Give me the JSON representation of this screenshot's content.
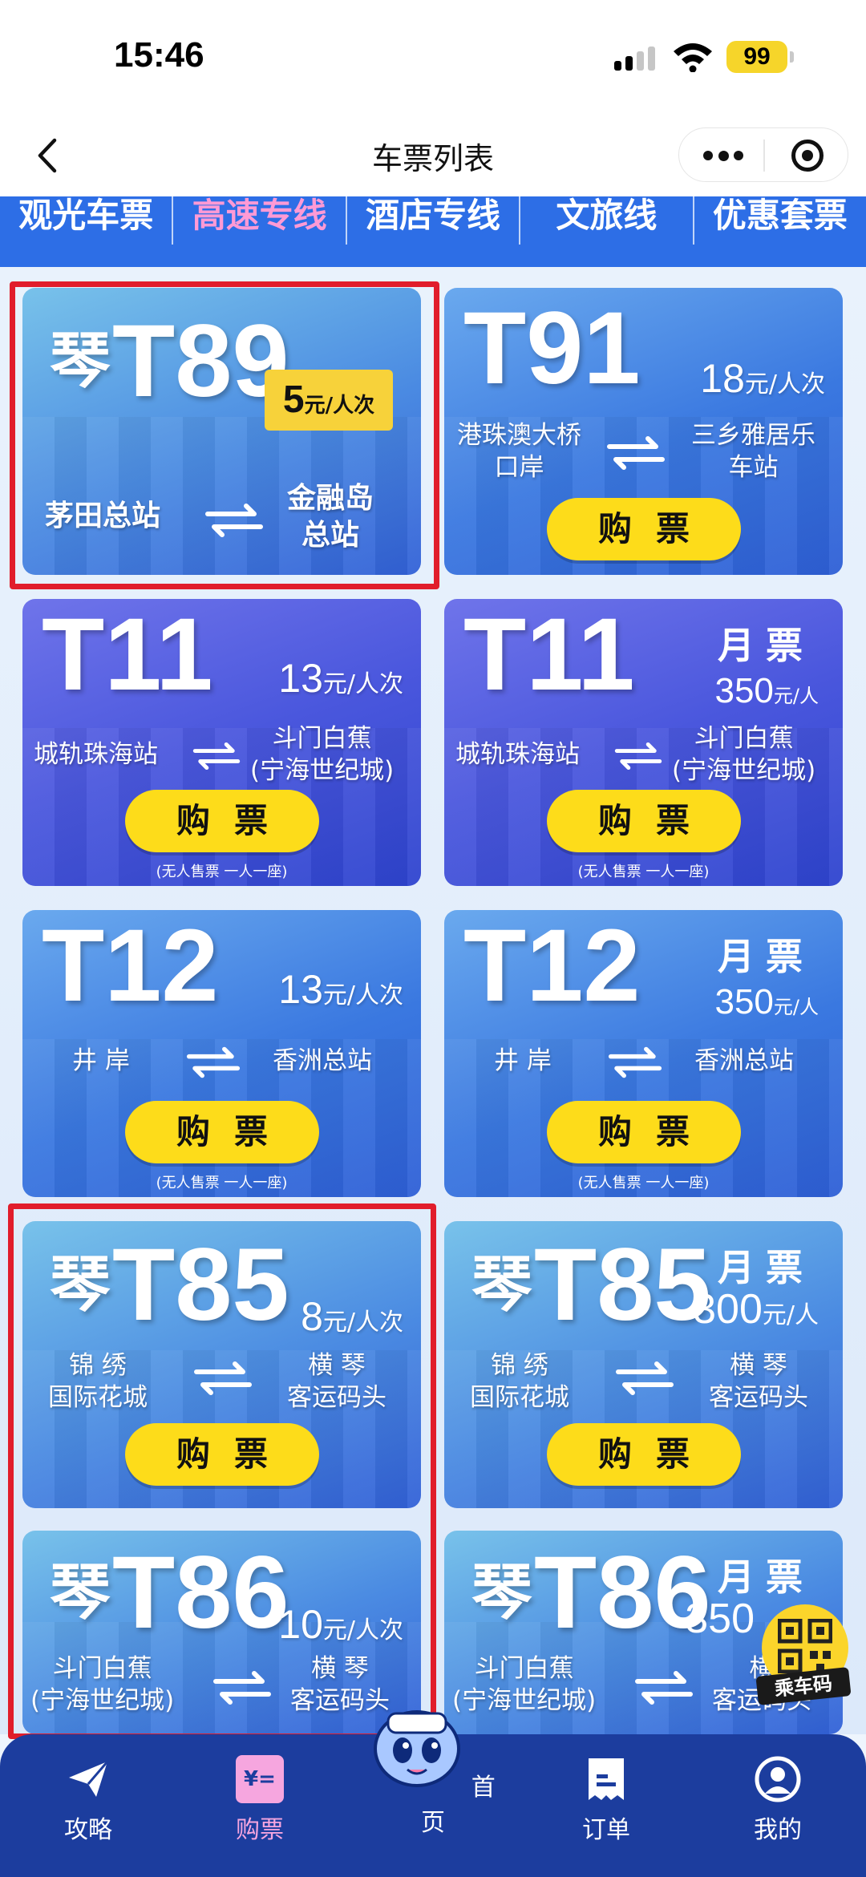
{
  "status": {
    "time": "15:46",
    "battery": "99"
  },
  "nav": {
    "title": "车票列表"
  },
  "tabs": [
    "观光车票",
    "高速专线",
    "酒店专线",
    "文旅线",
    "优惠套票"
  ],
  "cards": {
    "t89": {
      "qin": "琴",
      "route": "T89",
      "price": "5",
      "unit": "元/人次",
      "from": "茅田总站",
      "to_l1": "金融岛",
      "to_l2": "总站"
    },
    "t91": {
      "route": "T91",
      "price": "18",
      "unit": "元/人次",
      "from_l1": "港珠澳大桥",
      "from_l2": "口岸",
      "to_l1": "三乡雅居乐",
      "to_l2": "车站",
      "buy": "购票"
    },
    "t11": {
      "route": "T11",
      "price": "13",
      "unit": "元/人次",
      "from": "城轨珠海站",
      "to_l1": "斗门白蕉",
      "to_l2": "(宁海世纪城)",
      "buy": "购票",
      "note": "(无人售票  一人一座)"
    },
    "t11m": {
      "route": "T11",
      "monthly": "月票",
      "price": "350",
      "unit": "元/人",
      "from": "城轨珠海站",
      "to_l1": "斗门白蕉",
      "to_l2": "(宁海世纪城)",
      "buy": "购票",
      "note": "(无人售票  一人一座)"
    },
    "t12": {
      "route": "T12",
      "price": "13",
      "unit": "元/人次",
      "from": "井 岸",
      "to": "香洲总站",
      "buy": "购票",
      "note": "(无人售票  一人一座)"
    },
    "t12m": {
      "route": "T12",
      "monthly": "月票",
      "price": "350",
      "unit": "元/人",
      "from": "井 岸",
      "to": "香洲总站",
      "buy": "购票",
      "note": "(无人售票  一人一座)"
    },
    "t85": {
      "qin": "琴",
      "route": "T85",
      "price": "8",
      "unit": "元/人次",
      "from_l1": "锦 绣",
      "from_l2": "国际花城",
      "to_l1": "横 琴",
      "to_l2": "客运码头",
      "buy": "购票"
    },
    "t85m": {
      "qin": "琴",
      "route": "T85",
      "monthly": "月票",
      "price": "300",
      "unit": "元/人",
      "from_l1": "锦 绣",
      "from_l2": "国际花城",
      "to_l1": "横 琴",
      "to_l2": "客运码头",
      "buy": "购票"
    },
    "t86": {
      "qin": "琴",
      "route": "T86",
      "price": "10",
      "unit": "元/人次",
      "from_l1": "斗门白蕉",
      "from_l2": "(宁海世纪城)",
      "to_l1": "横 琴",
      "to_l2": "客运码头"
    },
    "t86m": {
      "qin": "琴",
      "route": "T86",
      "monthly": "月票",
      "price": "350",
      "from_l1": "斗门白蕉",
      "from_l2": "(宁海世纪城)",
      "to_l1": "横",
      "to_l2": "客运码头"
    }
  },
  "qr": {
    "label": "乘车码"
  },
  "bottom_nav": {
    "guide": "攻略",
    "buy": "购票",
    "buy_icon_text": "¥=",
    "home": "首页",
    "orders": "订单",
    "me": "我的"
  },
  "colors": {
    "tab_bg": "#2d6ee6",
    "active_tab": "#ff9ad5",
    "button": "#fddc1a",
    "highlight": "#e11d2b",
    "bottom_nav": "#1c3d9e"
  }
}
